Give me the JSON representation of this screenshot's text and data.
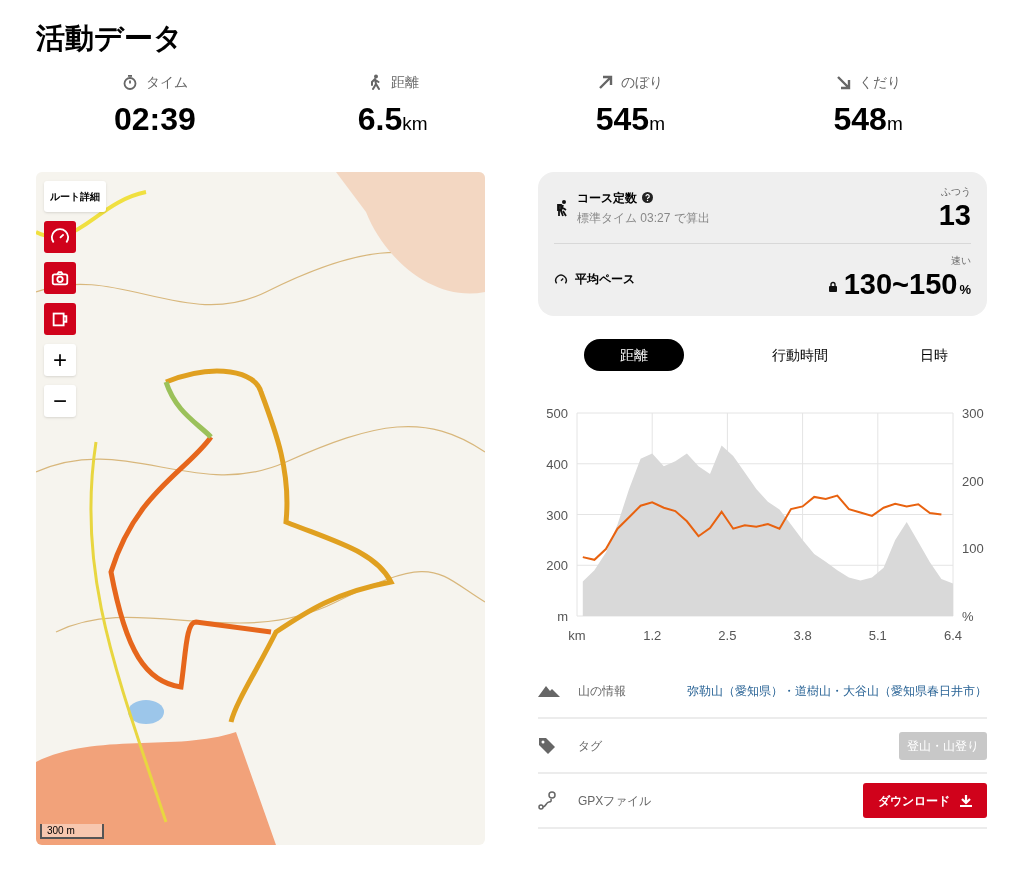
{
  "title": "活動データ",
  "stats": [
    {
      "kind": "time",
      "label": "タイム",
      "value": "02:39"
    },
    {
      "kind": "distance",
      "label": "距離",
      "value": "6.5",
      "unit": "km"
    },
    {
      "kind": "up",
      "label": "のぼり",
      "value": "545",
      "unit": "m"
    },
    {
      "kind": "down",
      "label": "くだり",
      "value": "548",
      "unit": "m"
    }
  ],
  "map": {
    "route_button": "ルート詳細",
    "tools": [
      {
        "kind": "pace"
      },
      {
        "kind": "camera"
      },
      {
        "kind": "cup"
      }
    ],
    "zoom_in": "+",
    "zoom_out": "−",
    "scale": "300 m"
  },
  "course": {
    "label": "コース定数",
    "note": "標準タイム 03:27 で算出",
    "rating": "ふつう",
    "value": "13"
  },
  "pace": {
    "label": "平均ペース",
    "rating": "速い",
    "value": "130~150",
    "unit": "%"
  },
  "tabs": [
    {
      "label": "距離",
      "selected": true
    },
    {
      "label": "行動時間",
      "selected": false
    },
    {
      "label": "日時",
      "selected": false
    }
  ],
  "chart_data": {
    "type": "area",
    "x": [
      0,
      0.2,
      0.4,
      0.6,
      0.8,
      1.0,
      1.2,
      1.4,
      1.6,
      1.8,
      2.0,
      2.2,
      2.4,
      2.6,
      2.8,
      3.0,
      3.2,
      3.4,
      3.6,
      3.8,
      4.0,
      4.2,
      4.4,
      4.6,
      4.8,
      5.0,
      5.2,
      5.4,
      5.6,
      5.8,
      6.0,
      6.2,
      6.4
    ],
    "series": [
      {
        "color": "#d9d9d9",
        "values": [
          168,
          190,
          225,
          280,
          350,
          410,
          420,
          395,
          405,
          420,
          395,
          380,
          436,
          415,
          383,
          350,
          325,
          310,
          280,
          250,
          222,
          207,
          190,
          176,
          170,
          176,
          195,
          250,
          285,
          246,
          206,
          173,
          164
        ]
      },
      {
        "color": "#e8620f",
        "type": "line",
        "axis": "y2",
        "values": [
          87,
          83,
          99,
          129,
          146,
          163,
          168,
          160,
          155,
          140,
          118,
          130,
          154,
          129,
          134,
          132,
          136,
          129,
          158,
          162,
          176,
          173,
          178,
          158,
          153,
          148,
          160,
          166,
          162,
          165,
          152,
          150,
          null
        ]
      }
    ],
    "grid": true,
    "xlim": [
      -0.1,
      6.4
    ],
    "ylim": [
      100,
      500
    ],
    "y2lim": [
      0,
      300
    ],
    "xticks": [
      {
        "value": -0.1,
        "label": "km"
      },
      1.2,
      2.5,
      3.8,
      5.1,
      6.4
    ],
    "yticks": [
      {
        "value": 100,
        "label": "m"
      },
      200,
      300,
      400,
      500
    ],
    "y2ticks": [
      {
        "value": 0,
        "label": "%"
      },
      100,
      200,
      300
    ]
  },
  "info": [
    {
      "kind": "mountain",
      "label": "山の情報",
      "link": "弥勒山（愛知県）・道樹山・大谷山（愛知県春日井市）"
    },
    {
      "kind": "tags",
      "label": "タグ",
      "tags": [
        "登山・山登り"
      ]
    },
    {
      "kind": "gpx",
      "label": "GPXファイル",
      "button": "ダウンロード"
    }
  ]
}
